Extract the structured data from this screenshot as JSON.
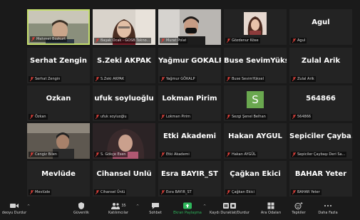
{
  "participants": [
    {
      "name": "",
      "label": "Mehmet Bozkurt"
    },
    {
      "name": "",
      "label": "Başak Ocak - GOSB Tekno..."
    },
    {
      "name": "",
      "label": "Murat Polat"
    },
    {
      "name": "",
      "label": "Gözdenur Köse"
    },
    {
      "name": "Agul",
      "label": "Agul"
    },
    {
      "name": "Serhat Zengin",
      "label": "Serhat Zengin"
    },
    {
      "name": "S.Zeki AKPAK",
      "label": "S.Zeki AKPAK"
    },
    {
      "name": "Yağmur GÖKALP",
      "label": "Yağmur GÖKALP"
    },
    {
      "name": "Buse SevimYüksel",
      "label": "Buse SevimYüksel"
    },
    {
      "name": "Zulal Arik",
      "label": "Zulal Arik"
    },
    {
      "name": "Özkan",
      "label": "Özkan"
    },
    {
      "name": "ufuk soyluoğlu",
      "label": "ufuk soyluoğlu"
    },
    {
      "name": "Lokman Pirim",
      "label": "Lokman Pirim"
    },
    {
      "name": "",
      "label": "Sezgi Şenel Belhan",
      "avatar_letter": "S"
    },
    {
      "name": "564866",
      "label": "564866"
    },
    {
      "name": "",
      "label": "Cengiz Bilen"
    },
    {
      "name": "",
      "label": "S. Gökçe Esen"
    },
    {
      "name": "Etki Akademi",
      "label": "Etki Akademi"
    },
    {
      "name": "Hakan AYGÜL",
      "label": "Hakan AYGÜL"
    },
    {
      "name": "Sepiciler  Çayba...",
      "label": "Sepiciler Çaybaşı Deri Sa..."
    },
    {
      "name": "Mevlüde",
      "label": "Mevlüde"
    },
    {
      "name": "Cihansel Ünlü",
      "label": "Cihansel Ünlü"
    },
    {
      "name": "Esra BAYIR_ST",
      "label": "Esra BAYIR_ST"
    },
    {
      "name": "Çağkan Ekici",
      "label": "Çağkan Ekici"
    },
    {
      "name": "BAHAR Yeter",
      "label": "BAHAR Yeter"
    }
  ],
  "toolbar": {
    "video": "deoyu Durdur",
    "security": "Güvenlik",
    "participants_count": "35",
    "participants": "Katılımcılar",
    "chat": "Sohbet",
    "share": "Ekran Paylaşma",
    "record": "Kaydı Duraklat/Durdur",
    "breakout": "Ara Odaları",
    "reactions": "Tepkiler",
    "more": "Daha Fazla"
  },
  "colors": {
    "active_speaker_border": "#c6e06f",
    "muted_icon": "#e0403a",
    "share_button": "#2eb85c",
    "avatar_bg": "#6aa84f"
  }
}
